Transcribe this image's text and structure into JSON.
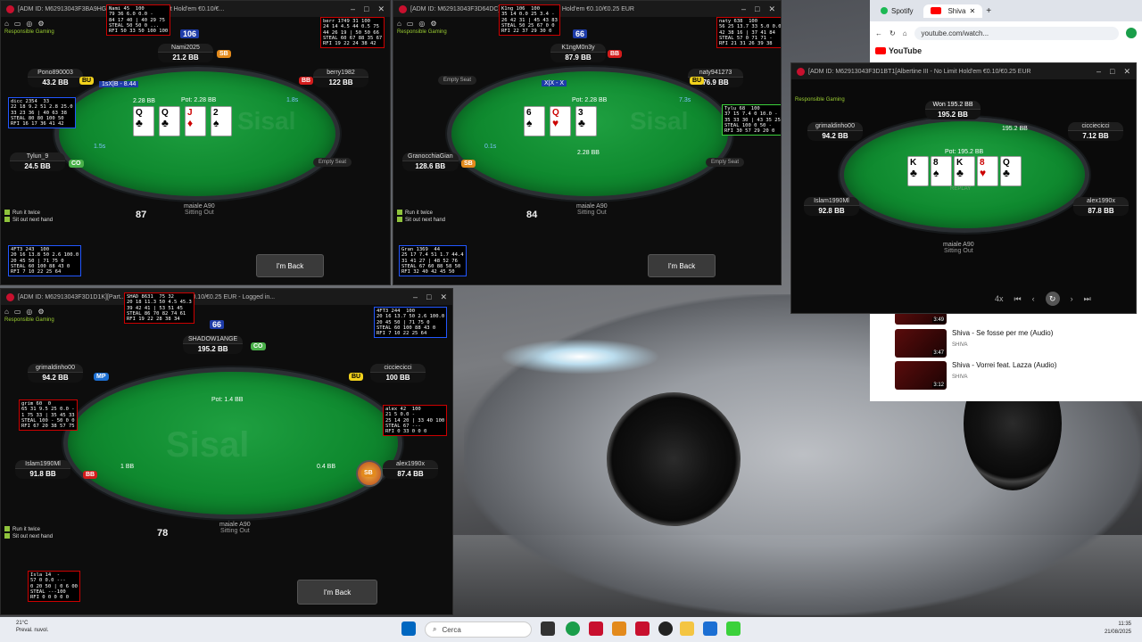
{
  "table1": {
    "title": "[ADM ID: M62913043F3BA9HG] ... Mentha V - No Limit Hold'em €0.10/€...",
    "responsible": "Responsible Gaming",
    "pot": "Pot: 2.28 BB",
    "small_pot": "2.28 BB",
    "board": [
      {
        "rank": "Q",
        "suit": "♣",
        "red": false
      },
      {
        "rank": "Q",
        "suit": "♣",
        "red": false
      },
      {
        "rank": "J",
        "suit": "♦",
        "red": true
      },
      {
        "rank": "2",
        "suit": "♠",
        "red": false
      }
    ],
    "seats": {
      "top": {
        "num": "106",
        "name": "Nami2025",
        "stack": "21.2 BB",
        "badge": "SB"
      },
      "left_top": {
        "name": "Pono890003",
        "stack": "43.2 BB",
        "badge": "BU"
      },
      "right_top": {
        "name": "berry1982",
        "stack": "122 BB",
        "badge": "BB"
      },
      "left_bottom": {
        "name": "Tylun_9",
        "stack": "24.5 BB",
        "badge": "CO"
      },
      "right_bottom": {
        "name": "Empty Seat"
      }
    },
    "action_tag": "1sX|B - 8.44",
    "time_left": "1.8s",
    "time_left2": "1.5s",
    "counter": "87",
    "hero_name": "maiale A90",
    "hero_status": "Sitting Out",
    "options": [
      "Run it twice",
      "Sit out next hand"
    ],
    "im_back": "I'm Back",
    "hud_top": "Nami 45  100\n79 36 6.0 0.0 -\n84 17 40 | 40 29 75\nSTEAL 50 50 0 ...\nRFI 50 33 50 100 100",
    "hud_top2": "berr 1749 31 100\n24 14 4.5 44 0.5 75\n44 26 19 | 50 50 66\nSTEAL 60 67 88 35 67\nRFI 19 22 24 38 42",
    "hud_left": "dicc 2354  33\n22 18 9.2 51 2.8 25.0\n33 23 36 | 40 63 38\nSTEAL 80 80 100 50\nRFI 16 17 36 41 42",
    "hud_bottom": "4FT3 243  100\n20 16 13.8 50 2.6 100.0\n20 45 50 | 71 75 0\nSTEAL 60 100 88 43 0\nRFI 7 10 22 25 64"
  },
  "table2": {
    "title": "[ADM ID: M62913043F3D64DC] ... Welch V - No Limit Hold'em €0.10/€0.25 EUR",
    "responsible": "Responsible Gaming",
    "pot": "Pot: 2.28 BB",
    "small_pot": "2.28 BB",
    "board": [
      {
        "rank": "6",
        "suit": "♠",
        "red": false
      },
      {
        "rank": "Q",
        "suit": "♥",
        "red": true
      },
      {
        "rank": "3",
        "suit": "♣",
        "red": false
      }
    ],
    "seats": {
      "top": {
        "num": "66",
        "name": "K1ngM0n3y",
        "stack": "87.9 BB",
        "badge": "BB"
      },
      "left_top": {
        "name": "Empty Seat"
      },
      "right_top": {
        "name": "naty941273",
        "stack": "76.9 BB",
        "badge": "BU"
      },
      "left_bottom": {
        "name": "GranocchiaGian",
        "stack": "128.6 BB",
        "badge": "SB"
      },
      "right_bottom": {
        "name": "Empty Seat"
      }
    },
    "action_tag": "X|X - X",
    "time_left": "7.3s",
    "time_left2": "0.1s",
    "counter": "84",
    "hero_name": "maiale A90",
    "hero_status": "Sitting Out",
    "options": [
      "Run it twice",
      "Sit out next hand"
    ],
    "im_back": "I'm Back",
    "hud_top": "K1ng 106  100\n35 14 0.0 25 3.4 -\n26 42 31 | 45 43 83\nSTEAL 50 25 67 0 0\nRFI 22 37 29 30 0",
    "hud_right": "naty 638  100\n56 25 13.7 33 5.0 0.0\n42 38 16 | 37 41 84\nSTEAL 57 0 71 71 -\nRFI 21 31 26 39 38",
    "hud_right2": "Tylu 68  100\n37 15 7.4 0 10.0 -\n35 33 30 | 43 35 25\nSTEAL 100 0 50 -\nRFI 30 57 29 20 0",
    "hud_bottom": "Gran 1369  44\n25 17 7.4 51 1.7 44.4\n31 41 27 | 48 52 76\nSTEAL 67 60 88 58 50\nRFI 32 40 42 45 50"
  },
  "table3": {
    "title": "[ADM ID: M62913043F3D1D1K][Part...] ... - No Limit Hold'em €0.10/€0.25 EUR - Logged in...",
    "responsible": "Responsible Gaming",
    "pot": "Pot: 1.4 BB",
    "seats": {
      "top": {
        "num": "66",
        "name": "SHADOW1ANGE",
        "stack": "195.2 BB",
        "badge": "CO"
      },
      "left_top": {
        "name": "grimaldinho00",
        "stack": "94.2 BB",
        "badge": "MP"
      },
      "right_top": {
        "name": "cicciecicci",
        "stack": "100 BB",
        "badge": "BU"
      },
      "left_bottom": {
        "name": "Islam1990Ml",
        "stack": "91.8 BB",
        "badge": "BB",
        "bet": "1 BB"
      },
      "right_bottom": {
        "name": "alex1990x",
        "stack": "87.4 BB",
        "badge": "SB",
        "bet": "0.4 BB"
      }
    },
    "counter": "78",
    "hero_name": "maiale A90",
    "hero_status": "Sitting Out",
    "options": [
      "Run it twice",
      "Sit out next hand"
    ],
    "im_back": "I'm Back",
    "hud_top": "SHAD 8631  75 32\n20 18 11.3 50 4.5 45.3\n39 42 41 | 53 51 45\nSTEAL 86 70 82 74 61\nRFI 19 22 28 38 34",
    "hud_right": "4FT3 244  100\n20 16 13.7 50 2.6 100.0\n20 45 50 | 71 75 0\nSTEAL 60 100 88 43 0\nRFI 7 10 22 25 64",
    "hud_left": "grim 60  0\n65 31 9.5 25 0.0 -\n1 75 33 | 35 45 33\nSTEAL 100 - 50 0 0\nRFI 67 20 38 57 75",
    "hud_right2": "alex 42  100\n21 5 0.0 -\n25 14 20 | 33 40 100\nSTEAL 67 ---\nRFI 0 33 0 0 0",
    "hud_bottom": "Isla 14  -\n57 0 0.0 ---\n0 20 50 | 0 6 00\nSTEAL ---100\nRFI 0 0 0 0 0"
  },
  "replay": {
    "title": "[ADM ID: M62913043F3D1BT1[Albertine III - No Limit Hold'em €0.10/€0.25 EUR",
    "responsible": "Responsible Gaming",
    "winner": "Won 195.2 BB",
    "pot": "Pot: 195.2 BB",
    "replay_label": "REPLAY",
    "board": [
      {
        "rank": "K",
        "suit": "♣",
        "red": false
      },
      {
        "rank": "8",
        "suit": "♠",
        "red": false
      },
      {
        "rank": "K",
        "suit": "♣",
        "red": false
      },
      {
        "rank": "8",
        "suit": "♥",
        "red": true
      },
      {
        "rank": "Q",
        "suit": "♣",
        "red": false
      }
    ],
    "seats": {
      "top": {
        "name": "Won 195.2 BB",
        "stack": "195.2 BB"
      },
      "left_top": {
        "name": "grimaldinho00",
        "stack": "94.2 BB"
      },
      "right_top": {
        "name": "cicciecicci",
        "stack": "7.12 BB"
      },
      "left_bottom": {
        "name": "Islam1990Ml",
        "stack": "92.8 BB"
      },
      "right_bottom": {
        "name": "alex1990x",
        "stack": "87.8 BB"
      }
    },
    "side_pot": "195.2 BB",
    "hero_name": "maiale A90",
    "hero_status": "Sitting Out",
    "speed": "4x"
  },
  "browser": {
    "tabs": [
      "Spotify",
      "Shiva"
    ],
    "url": "youtube.com/watch...",
    "youtube": "YouTube",
    "playlist": [
      {
        "title": "Shiva - Se fosse per me (Audio)",
        "channel": "SHIVA",
        "duration": "3:47"
      },
      {
        "title": "Shiva - Vorrei feat. Lazza (Audio)",
        "channel": "SHIVA",
        "duration": "3:12"
      }
    ],
    "prev_duration": "3:49"
  },
  "taskbar": {
    "weather_temp": "21°C",
    "weather_desc": "Preval. nuvol.",
    "search": "Cerca",
    "time": "11:35",
    "date": "21/08/2025"
  }
}
